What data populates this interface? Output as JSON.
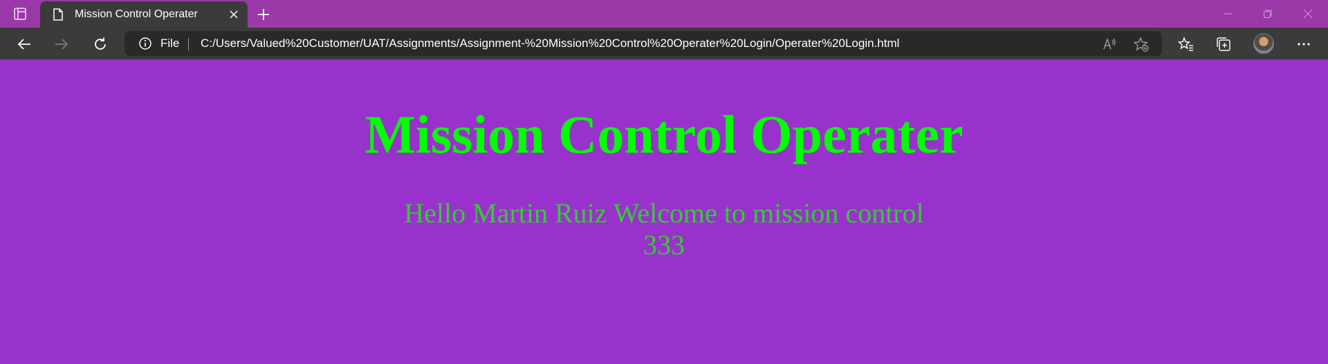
{
  "browser": {
    "tab": {
      "title": "Mission Control Operater",
      "icon": "page-icon",
      "close_icon": "close-icon"
    },
    "new_tab_icon": "plus-icon",
    "window_controls": [
      "minimize-icon",
      "restore-icon",
      "close-icon"
    ],
    "address_bar": {
      "info_icon": "info-icon",
      "scheme_label": "File",
      "url": "C:/Users/Valued%20Customer/UAT/Assignments/Assignment-%20Mission%20Control%20Operater%20Login/Operater%20Login.html"
    },
    "toolbar_icons": [
      "back-icon",
      "forward-icon",
      "refresh-icon",
      "read-aloud-icon",
      "add-favorite-icon",
      "favorites-icon",
      "collections-icon",
      "avatar",
      "more-icon"
    ]
  },
  "page": {
    "heading": "Mission Control Operater",
    "welcome_line_1": "Hello Martin Ruiz Welcome to mission control",
    "welcome_line_2": "333"
  },
  "colors": {
    "page_background": "#9932cc",
    "heading": "#00ff00",
    "welcome_text": "#32cd32",
    "tabstrip": "#9b39a8",
    "toolbar": "#3b3b3b"
  }
}
